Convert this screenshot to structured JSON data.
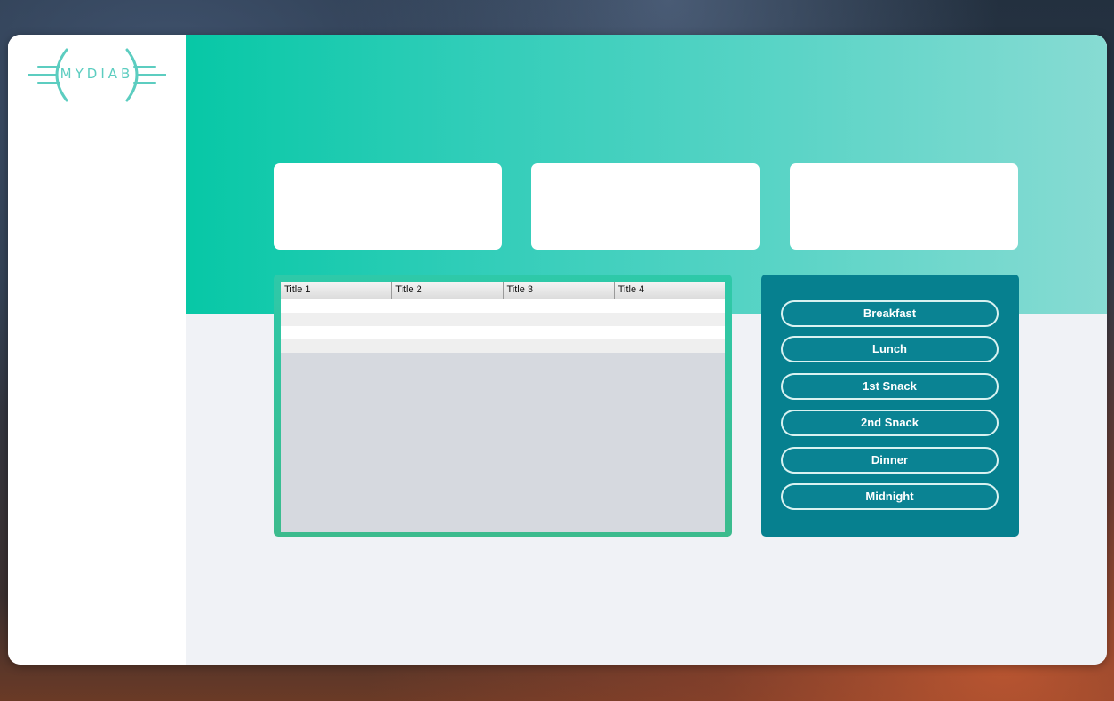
{
  "logo": {
    "text": "MYDIAB"
  },
  "table": {
    "columns": [
      "Title 1",
      "Title 2",
      "Title 3",
      "Title 4"
    ],
    "rows": [
      [
        "",
        "",
        "",
        ""
      ],
      [
        "",
        "",
        "",
        ""
      ],
      [
        "",
        "",
        "",
        ""
      ],
      [
        "",
        "",
        "",
        ""
      ]
    ]
  },
  "meals": {
    "buttons": [
      "Breakfast",
      "Lunch",
      "1st Snack",
      "2nd Snack",
      "Dinner",
      "Midnight"
    ]
  },
  "colors": {
    "accent_teal": "#07c8a6",
    "panel_dark_teal": "#06808f",
    "logo_teal": "#5ccdc0"
  }
}
